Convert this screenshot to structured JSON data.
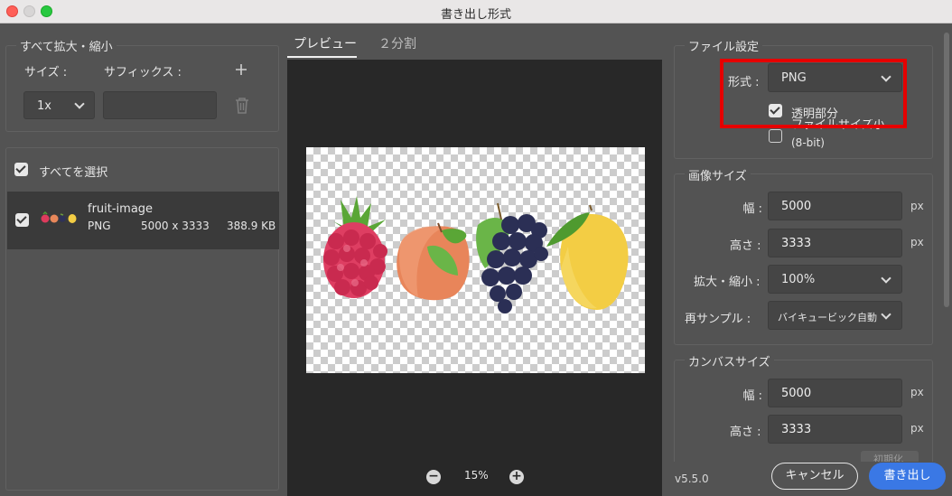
{
  "window": {
    "title": "書き出し形式"
  },
  "size_panel": {
    "legend": "すべて拡大・縮小",
    "size_label": "サイズ :",
    "suffix_label": "サフィックス :",
    "scale_value": "1x",
    "suffix_value": "",
    "add_icon": "plus-icon",
    "delete_icon": "trash-icon"
  },
  "assets": {
    "select_all_label": "すべてを選択",
    "select_all_checked": true,
    "items": [
      {
        "name": "fruit-image",
        "format": "PNG",
        "dimensions": "5000 x 3333",
        "size": "388.9 KB",
        "checked": true
      }
    ]
  },
  "preview": {
    "tabs": [
      {
        "label": "プレビュー",
        "active": true
      },
      {
        "label": "２分割",
        "active": false
      }
    ],
    "zoom_label": "15%",
    "zoom_out_icon": "minus-circle-icon",
    "zoom_in_icon": "plus-circle-icon"
  },
  "file_settings": {
    "legend": "ファイル設定",
    "format_label": "形式 :",
    "format_value": "PNG",
    "transparency_label": "透明部分",
    "transparency_checked": true,
    "smaller_file_label": "ファイルサイズ小",
    "smaller_file_sub": "(8-bit)",
    "smaller_file_checked": false
  },
  "image_size": {
    "legend": "画像サイズ",
    "width_label": "幅 :",
    "width_value": "5000",
    "height_label": "高さ :",
    "height_value": "3333",
    "scale_label": "拡大・縮小 :",
    "scale_value": "100%",
    "resample_label": "再サンプル :",
    "resample_value": "バイキュービック自動",
    "unit": "px"
  },
  "canvas_size": {
    "legend": "カンバスサイズ",
    "width_label": "幅 :",
    "width_value": "5000",
    "height_label": "高さ :",
    "height_value": "3333",
    "unit": "px",
    "reset_label": "初期化"
  },
  "footer": {
    "version": "v5.5.0",
    "cancel_label": "キャンセル",
    "export_label": "書き出し"
  },
  "colors": {
    "accent": "#3a78e5",
    "highlight": "#e50000",
    "panel_bg": "#535353"
  }
}
